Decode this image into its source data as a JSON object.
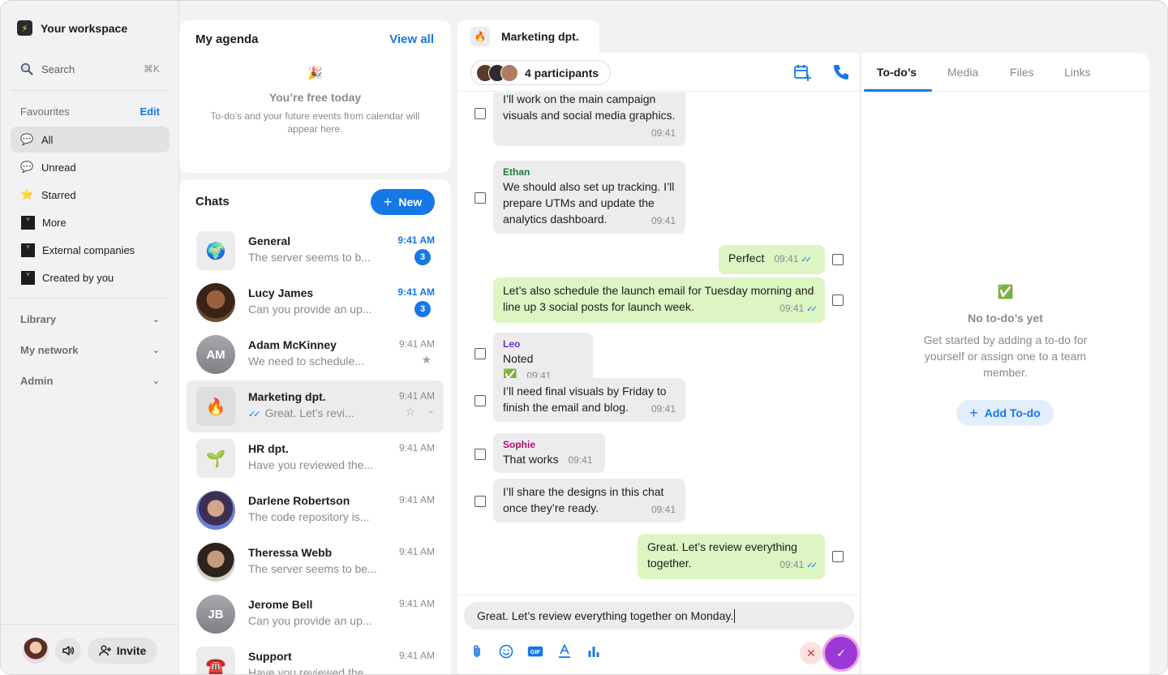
{
  "workspace": {
    "name": "Your workspace",
    "logo_icon": "lightning-icon"
  },
  "search": {
    "label": "Search",
    "shortcut": "⌘K"
  },
  "favourites": {
    "title": "Favourites",
    "edit_label": "Edit",
    "items": [
      {
        "label": "All",
        "icon": "chat-bubble-icon",
        "active": true
      },
      {
        "label": "Unread",
        "icon": "unread-bubble-icon"
      },
      {
        "label": "Starred",
        "icon": "star-icon"
      },
      {
        "label": "More",
        "icon": "caret-down-icon"
      },
      {
        "label": "External companies",
        "icon": "caret-down-icon"
      },
      {
        "label": "Created by you",
        "icon": "caret-down-icon"
      }
    ]
  },
  "sections": [
    {
      "label": "Library"
    },
    {
      "label": "My network"
    },
    {
      "label": "Admin"
    }
  ],
  "footer": {
    "invite_label": "Invite"
  },
  "agenda": {
    "title": "My agenda",
    "view_all": "View all",
    "empty_emoji": "🎉",
    "empty_title": "You’re free today",
    "empty_desc": "To-do’s and your future events from calendar will appear here."
  },
  "chats": {
    "title": "Chats",
    "new_label": "New",
    "items": [
      {
        "name": "General",
        "preview": "The server seems to b...",
        "time": "9:41 AM",
        "unread": "3",
        "avatar": "🌍"
      },
      {
        "name": "Lucy James",
        "preview": "Can you provide an up...",
        "time": "9:41 AM",
        "unread": "3"
      },
      {
        "name": "Adam McKinney",
        "preview": "We need to schedule...",
        "time": "9:41 AM",
        "initials": "AM",
        "starred": true
      },
      {
        "name": "Marketing dpt.",
        "preview": "Great. Let’s revi...",
        "time": "9:41 AM",
        "avatar": "🔥",
        "selected": true
      },
      {
        "name": "HR dpt.",
        "preview": "Have you reviewed the...",
        "time": "9:41 AM",
        "avatar": "🌱"
      },
      {
        "name": "Darlene Robertson",
        "preview": "The code repository is...",
        "time": "9:41 AM"
      },
      {
        "name": "Theressa Webb",
        "preview": "The server seems to be...",
        "time": "9:41 AM"
      },
      {
        "name": "Jerome Bell",
        "preview": "Can you provide an up...",
        "time": "9:41 AM",
        "initials": "JB"
      },
      {
        "name": "Support",
        "preview": "Have you reviewed the...",
        "time": "9:41 AM",
        "avatar": "☎️"
      }
    ]
  },
  "conversation": {
    "tab_title": "Marketing dpt.",
    "tab_icon": "🔥",
    "participants": "4 participants",
    "messages": [
      {
        "text": "I’ll work on the main campaign visuals and social media graphics.",
        "time": "09:41",
        "dir": "in"
      },
      {
        "sender": "Ethan",
        "sender_color": "#1e7a3c",
        "text": "We should also set up tracking. I’ll prepare UTMs and update the analytics dashboard.",
        "time": "09:41",
        "dir": "in"
      },
      {
        "text": "Perfect",
        "time": "09:41",
        "dir": "out"
      },
      {
        "text": "Let’s also schedule the launch email for Tuesday morning and line up 3 social posts for launch week.",
        "time": "09:41",
        "dir": "out"
      },
      {
        "sender": "Leo",
        "sender_color": "#6a2fd8",
        "text": "Noted ✅",
        "time": "09:41",
        "dir": "in"
      },
      {
        "text": "I’ll need final visuals by Friday to finish the email and blog.",
        "time": "09:41",
        "dir": "in"
      },
      {
        "sender": "Sophie",
        "sender_color": "#b0136e",
        "text": "That works",
        "time": "09:41",
        "dir": "in"
      },
      {
        "text": "I’ll share the designs in this chat once they’re ready.",
        "time": "09:41",
        "dir": "in"
      },
      {
        "text": "Great. Let’s review everything together.",
        "time": "09:41",
        "dir": "out"
      }
    ],
    "composer_value": "Great. Let’s review everything together on Monday.",
    "toolbar": [
      "attach-icon",
      "emoji-icon",
      "gif-icon",
      "text-format-icon",
      "poll-icon"
    ]
  },
  "right_panel": {
    "tabs": [
      "To-do’s",
      "Media",
      "Files",
      "Links"
    ],
    "active_tab": "To-do’s",
    "empty_icon": "✅",
    "empty_title": "No to-do’s yet",
    "empty_desc": "Get started by adding a to-do for yourself or assign one to a team member.",
    "add_label": "Add To-do"
  },
  "colors": {
    "accent": "#1677e6",
    "outgoing_bubble": "#dcf5c2",
    "incoming_bubble": "#ececee",
    "send_button": "#9b38d6"
  }
}
